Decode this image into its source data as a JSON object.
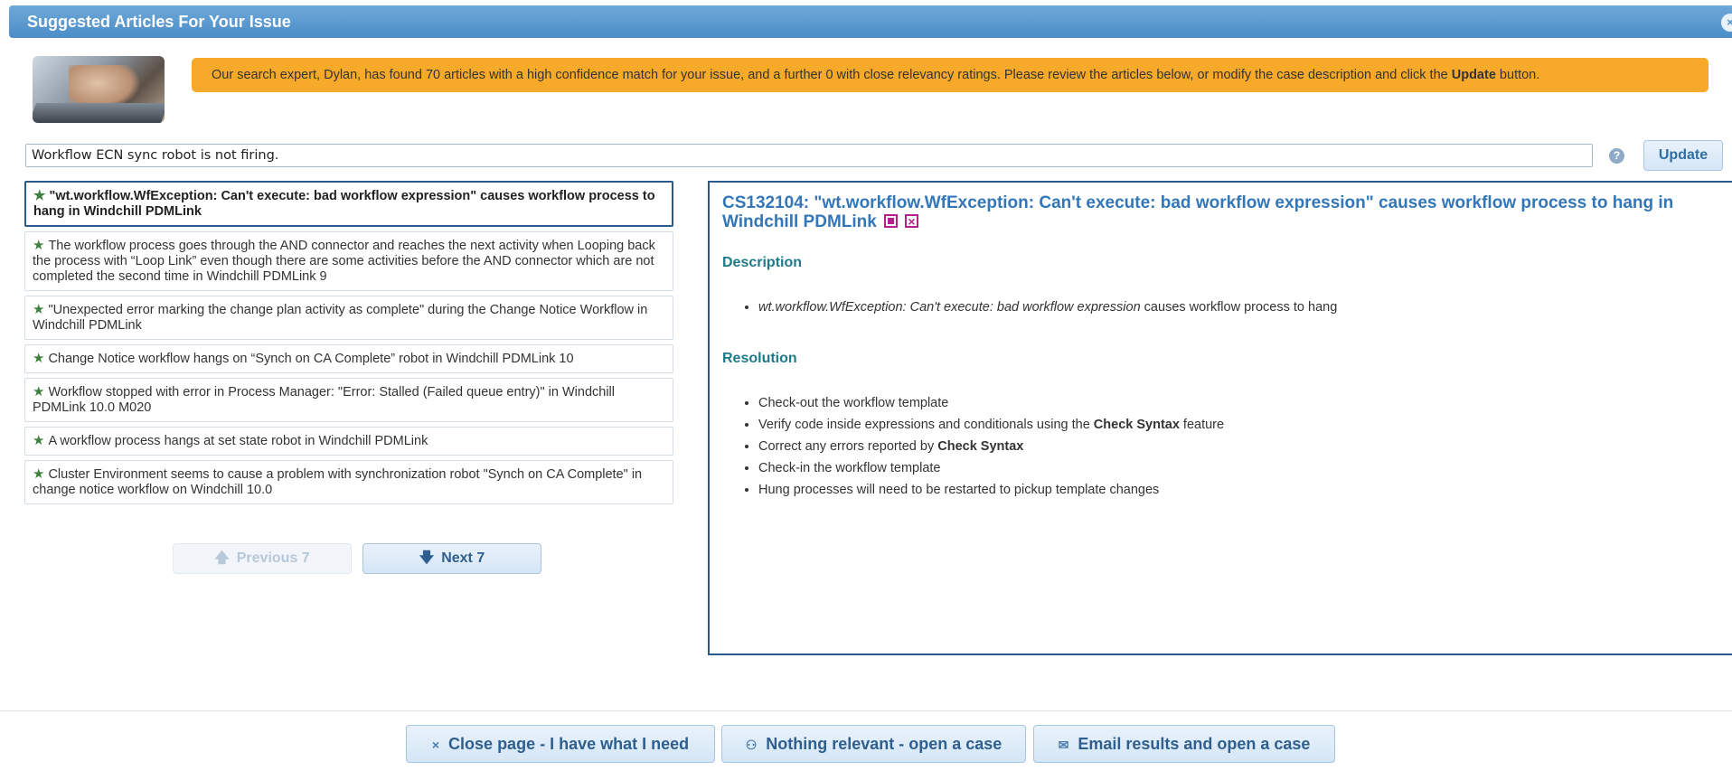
{
  "window": {
    "title": "Suggested Articles For Your Issue",
    "close_glyph": "×"
  },
  "banner": {
    "text_before": "Our search expert, Dylan, has found 70 articles with a high confidence match for your issue, and a further 0 with close relevancy ratings. Please review the articles below, or modify the case description and click the ",
    "text_bold": "Update",
    "text_after": " button."
  },
  "search": {
    "value": "Workflow ECN sync robot is not firing.",
    "help_glyph": "?",
    "update_label": "Update"
  },
  "articles": [
    {
      "title": "\"wt.workflow.WfException: Can't execute: bad workflow expression\" causes workflow process to hang in Windchill PDMLink"
    },
    {
      "title": "The workflow process goes through the AND connector and reaches the next activity when Looping back the process with “Loop Link” even though there are some activities before the AND connector which are not completed the second time in Windchill PDMLink 9"
    },
    {
      "title": "\"Unexpected error marking the change plan activity as complete\" during the Change Notice Workflow in Windchill PDMLink"
    },
    {
      "title": "Change Notice workflow hangs on “Synch on CA Complete” robot in Windchill PDMLink 10"
    },
    {
      "title": "Workflow stopped with error in Process Manager: \"Error: Stalled (Failed queue entry)\" in Windchill PDMLink 10.0 M020"
    },
    {
      "title": "A workflow process hangs at set state robot in Windchill PDMLink"
    },
    {
      "title": "Cluster Environment seems to cause a problem with synchronization robot \"Synch on CA Complete\" in change notice workflow on Windchill 10.0"
    }
  ],
  "star_glyph": "★",
  "pager": {
    "prev_label": "Previous 7",
    "next_label": "Next 7",
    "prev_arrow": "🡅",
    "next_arrow": "🡇"
  },
  "detail": {
    "title": "CS132104: \"wt.workflow.WfException: Can't execute: bad workflow expression\" causes workflow process to hang in Windchill PDMLink",
    "description_heading": "Description",
    "description_item_italic": "wt.workflow.WfException: Can't execute: bad workflow expression",
    "description_item_rest": " causes workflow process to hang",
    "resolution_heading": "Resolution",
    "resolution": [
      {
        "before": "Check-out the workflow template",
        "bold": "",
        "after": ""
      },
      {
        "before": "Verify code inside expressions and conditionals using the ",
        "bold": "Check Syntax",
        "after": " feature"
      },
      {
        "before": "Correct any errors reported by ",
        "bold": "Check Syntax",
        "after": ""
      },
      {
        "before": "Check-in the workflow template",
        "bold": "",
        "after": ""
      },
      {
        "before": "Hung processes will need to be restarted to pickup template changes",
        "bold": "",
        "after": ""
      }
    ]
  },
  "footer": {
    "close_icon": "×",
    "close_label": "Close page - I have what I need",
    "nothing_icon": "⚇",
    "nothing_label": "Nothing relevant - open a case",
    "email_icon": "✉",
    "email_label": "Email results and open a case"
  }
}
